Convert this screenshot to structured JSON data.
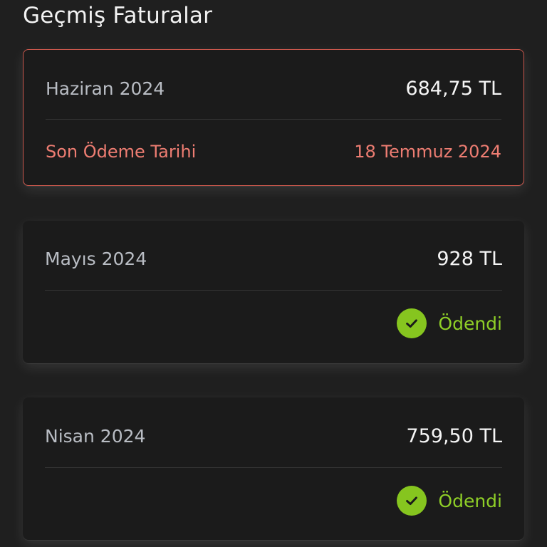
{
  "header": {
    "title": "Geçmiş Faturalar"
  },
  "invoices": [
    {
      "period": "Haziran 2024",
      "amount": "684,75 TL",
      "status_label": "Son Ödeme Tarihi",
      "due_date": "18 Temmuz 2024",
      "status": "due"
    },
    {
      "period": "Mayıs 2024",
      "amount": "928 TL",
      "status_label": "Ödendi",
      "status": "paid",
      "status_icon": "check-circle-icon"
    },
    {
      "period": "Nisan 2024",
      "amount": "759,50 TL",
      "status_label": "Ödendi",
      "status": "paid",
      "status_icon": "check-circle-icon"
    }
  ],
  "colors": {
    "background": "#1f1f1f",
    "card": "#1b1b1b",
    "due_accent": "#ee7d72",
    "due_border": "#c9574c",
    "paid_accent": "#86c51f"
  }
}
